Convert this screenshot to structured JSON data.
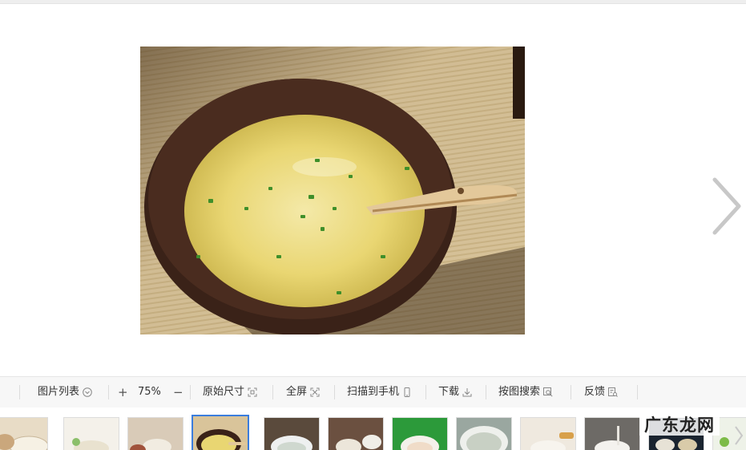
{
  "viewer": {
    "main_image_icon": "porridge-bowl-photo",
    "next_icon": "chevron-right-icon"
  },
  "toolbar": {
    "image_list_label": "图片列表",
    "zoom_in_symbol": "+",
    "zoom_value": "75%",
    "zoom_out_symbol": "−",
    "original_size_label": "原始尺寸",
    "fullscreen_label": "全屏",
    "scan_to_phone_label": "扫描到手机",
    "download_label": "下载",
    "search_by_image_label": "按图搜索",
    "feedback_label": "反馈"
  },
  "thumbnails": {
    "count": 12,
    "selected_index": 3
  },
  "watermark": {
    "text": "广东龙网"
  },
  "colors": {
    "accent": "#3b7ddd",
    "toolbar_bg": "#f7f7f7",
    "arrow": "#c8c8c8"
  }
}
